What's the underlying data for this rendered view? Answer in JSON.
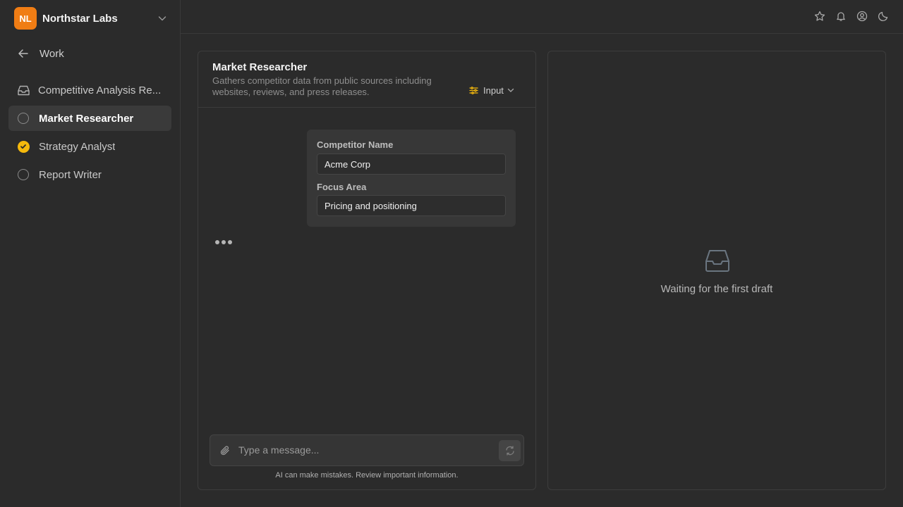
{
  "org": {
    "initials": "NL",
    "name": "Northstar Labs",
    "logo_color": "#f07d14"
  },
  "back": {
    "label": "Work"
  },
  "nav": {
    "project": {
      "label": "Competitive Analysis Re...",
      "icon": "inbox-icon"
    },
    "items": [
      {
        "label": "Market Researcher",
        "status": "pending",
        "active": true
      },
      {
        "label": "Strategy Analyst",
        "status": "done",
        "active": false
      },
      {
        "label": "Report Writer",
        "status": "pending",
        "active": false
      }
    ]
  },
  "topbar": {
    "icons": [
      "star-icon",
      "bell-icon",
      "user-circle-icon",
      "moon-icon"
    ]
  },
  "chat": {
    "title": "Market Researcher",
    "description": "Gathers competitor data from public sources including websites, reviews, and press releases.",
    "mode_label": "Input",
    "form": {
      "fields": [
        {
          "label": "Competitor Name",
          "value": "Acme Corp"
        },
        {
          "label": "Focus Area",
          "value": "Pricing and positioning"
        }
      ]
    },
    "composer": {
      "placeholder": "Type a message..."
    },
    "disclaimer": "AI can make mistakes. Review important information."
  },
  "draft": {
    "empty_text": "Waiting for the first draft"
  },
  "colors": {
    "accent": "#f5b90c",
    "background": "#2b2b2b"
  }
}
